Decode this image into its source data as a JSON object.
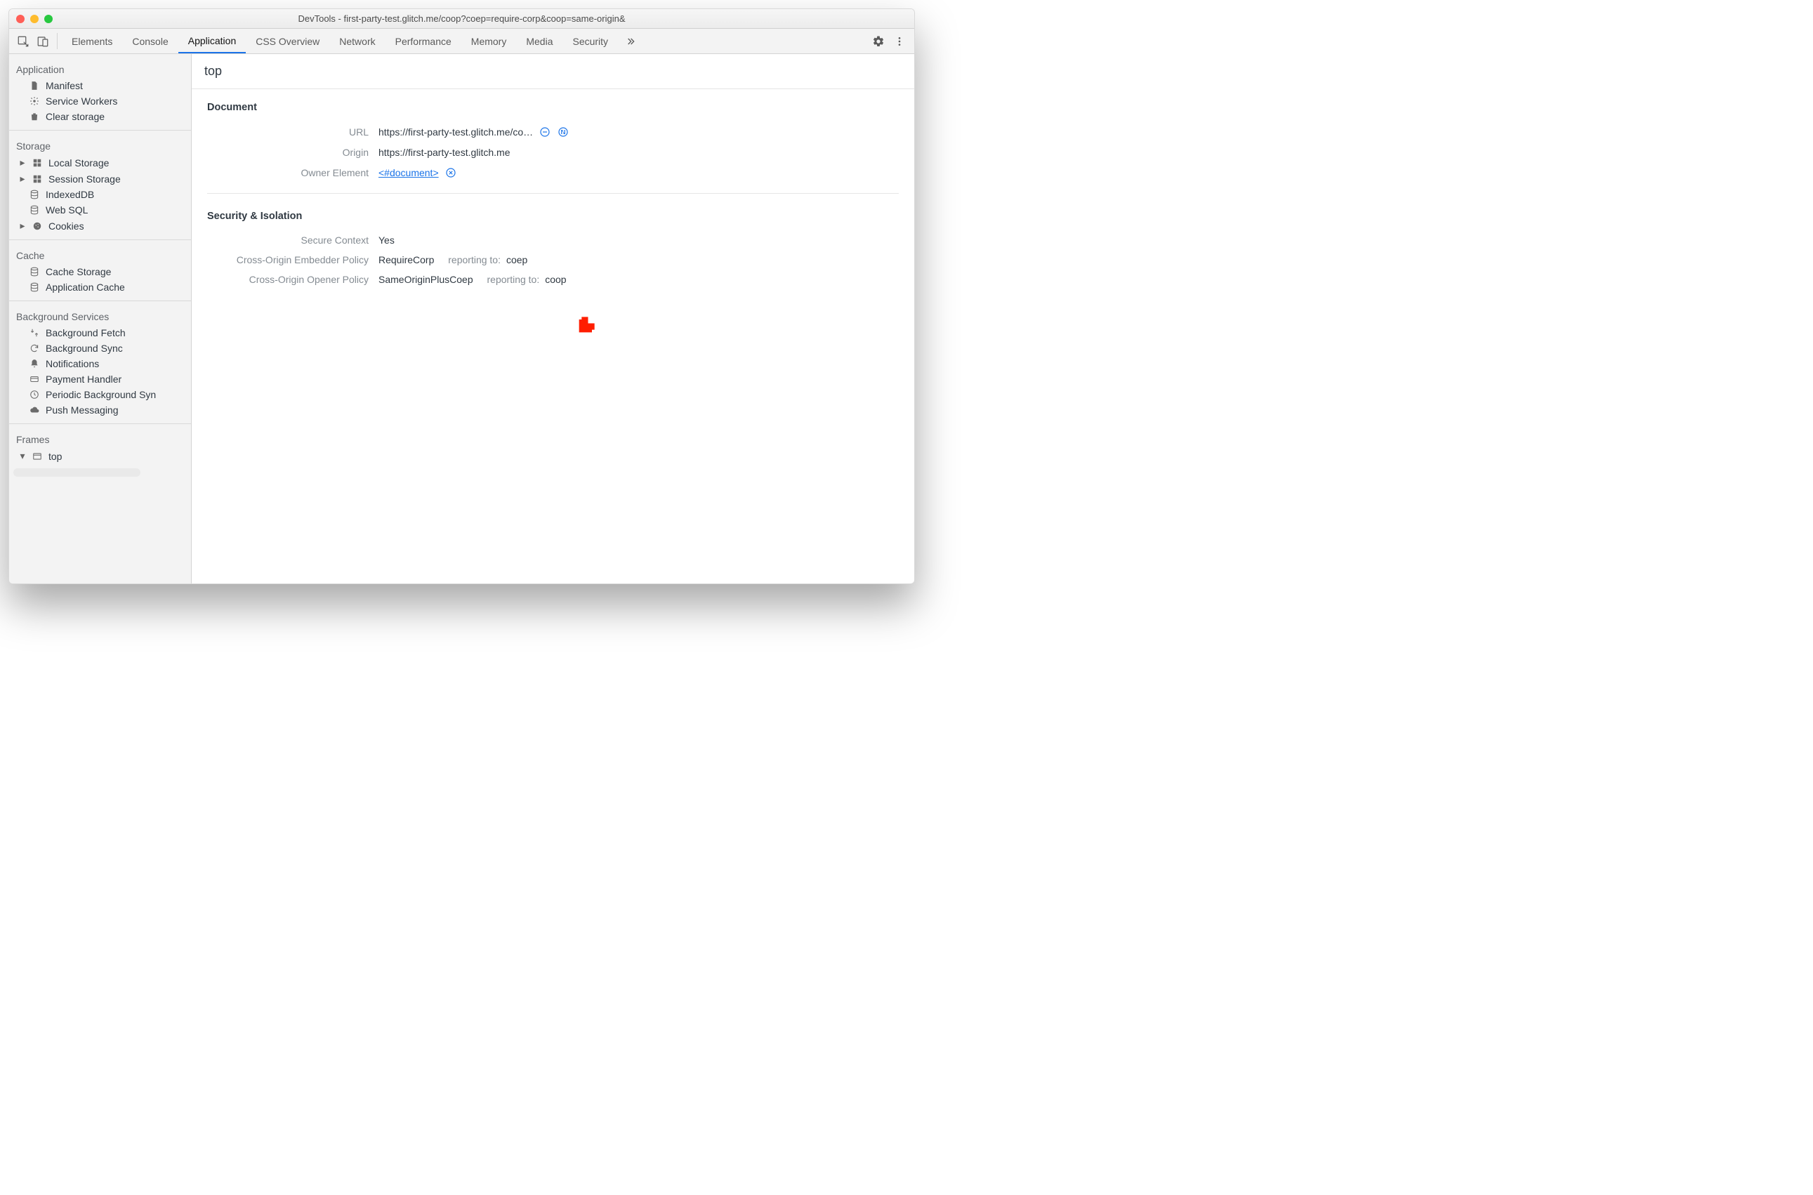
{
  "window": {
    "title": "DevTools - first-party-test.glitch.me/coop?coep=require-corp&coop=same-origin&"
  },
  "tabs": [
    {
      "label": "Elements",
      "active": false
    },
    {
      "label": "Console",
      "active": false
    },
    {
      "label": "Application",
      "active": true
    },
    {
      "label": "CSS Overview",
      "active": false
    },
    {
      "label": "Network",
      "active": false
    },
    {
      "label": "Performance",
      "active": false
    },
    {
      "label": "Memory",
      "active": false
    },
    {
      "label": "Media",
      "active": false
    },
    {
      "label": "Security",
      "active": false
    }
  ],
  "sidebar": {
    "application": {
      "title": "Application",
      "items": [
        {
          "icon": "file",
          "label": "Manifest"
        },
        {
          "icon": "gear",
          "label": "Service Workers"
        },
        {
          "icon": "trash",
          "label": "Clear storage"
        }
      ]
    },
    "storage": {
      "title": "Storage",
      "items": [
        {
          "icon": "grid",
          "label": "Local Storage",
          "disclosure": true
        },
        {
          "icon": "grid",
          "label": "Session Storage",
          "disclosure": true
        },
        {
          "icon": "db",
          "label": "IndexedDB"
        },
        {
          "icon": "db",
          "label": "Web SQL"
        },
        {
          "icon": "cookie",
          "label": "Cookies",
          "disclosure": true
        }
      ]
    },
    "cache": {
      "title": "Cache",
      "items": [
        {
          "icon": "db",
          "label": "Cache Storage"
        },
        {
          "icon": "db",
          "label": "Application Cache"
        }
      ]
    },
    "background": {
      "title": "Background Services",
      "items": [
        {
          "icon": "fetch",
          "label": "Background Fetch"
        },
        {
          "icon": "sync",
          "label": "Background Sync"
        },
        {
          "icon": "bell",
          "label": "Notifications"
        },
        {
          "icon": "card",
          "label": "Payment Handler"
        },
        {
          "icon": "clock",
          "label": "Periodic Background Syn"
        },
        {
          "icon": "cloud",
          "label": "Push Messaging"
        }
      ]
    },
    "frames": {
      "title": "Frames",
      "items": [
        {
          "icon": "frame",
          "label": "top",
          "disclosure": true,
          "open": true,
          "selected": false
        }
      ]
    }
  },
  "main": {
    "header": "top",
    "document": {
      "title": "Document",
      "url_label": "URL",
      "url_value": "https://first-party-test.glitch.me/co…",
      "origin_label": "Origin",
      "origin_value": "https://first-party-test.glitch.me",
      "owner_label": "Owner Element",
      "owner_value": "<#document>"
    },
    "security": {
      "title": "Security & Isolation",
      "secure_label": "Secure Context",
      "secure_value": "Yes",
      "coep_label": "Cross-Origin Embedder Policy",
      "coep_value": "RequireCorp",
      "coep_reporting_label": "reporting to:",
      "coep_reporting_value": "coep",
      "coop_label": "Cross-Origin Opener Policy",
      "coop_value": "SameOriginPlusCoep",
      "coop_reporting_label": "reporting to:",
      "coop_reporting_value": "coop"
    }
  },
  "colors": {
    "accent": "#1a73e8",
    "annotation": "#ff1e00"
  }
}
